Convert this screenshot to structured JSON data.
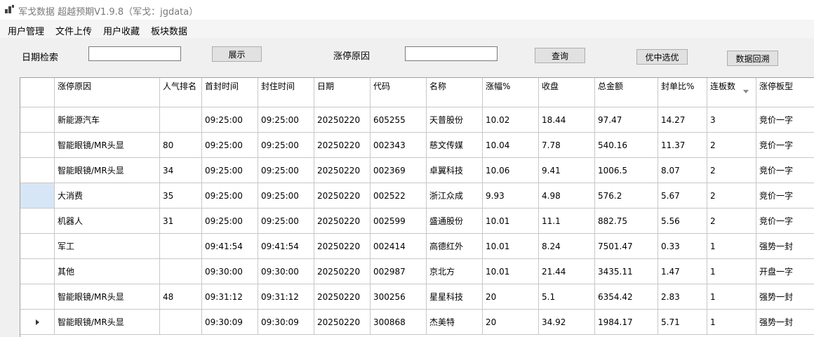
{
  "window": {
    "title": "军戈数据 超越预期V1.9.8（军戈：jgdata）"
  },
  "menu": [
    "用户管理",
    "文件上传",
    "用户收藏",
    "板块数据"
  ],
  "toolbar": {
    "date_label": "日期检索",
    "date_value": "",
    "show_button": "展示",
    "reason_label": "涨停原因",
    "reason_value": "",
    "query_button": "查询",
    "select_button": "优中选优",
    "backtest_button": "数据回溯"
  },
  "grid": {
    "columns": [
      [
        "涨停原因"
      ],
      [
        "人气",
        "排名"
      ],
      [
        "首封时",
        "间"
      ],
      [
        "封住时",
        "间"
      ],
      [
        "日期"
      ],
      [
        "代码"
      ],
      [
        "名称"
      ],
      [
        "涨幅%"
      ],
      [
        "收盘"
      ],
      [
        "总金额"
      ],
      [
        "封单",
        "比%"
      ],
      [
        "连板数"
      ],
      [
        "涨停板",
        "型"
      ]
    ],
    "rows": [
      [
        "新能源汽车",
        "",
        "09:25:00",
        "09:25:00",
        "20250220",
        "605255",
        "天普股份",
        "10.02",
        "18.44",
        "97.47",
        "14.27",
        "3",
        "竞价一字"
      ],
      [
        "智能眼镜/MR头显",
        "80",
        "09:25:00",
        "09:25:00",
        "20250220",
        "002343",
        "慈文传媒",
        "10.04",
        "7.78",
        "540.16",
        "11.37",
        "2",
        "竞价一字"
      ],
      [
        "智能眼镜/MR头显",
        "34",
        "09:25:00",
        "09:25:00",
        "20250220",
        "002369",
        "卓翼科技",
        "10.06",
        "9.41",
        "1006.5",
        "8.07",
        "2",
        "竞价一字"
      ],
      [
        "大消费",
        "35",
        "09:25:00",
        "09:25:00",
        "20250220",
        "002522",
        "浙江众成",
        "9.93",
        "4.98",
        "576.2",
        "5.67",
        "2",
        "竞价一字"
      ],
      [
        "机器人",
        "31",
        "09:25:00",
        "09:25:00",
        "20250220",
        "002599",
        "盛通股份",
        "10.01",
        "11.1",
        "882.75",
        "5.56",
        "2",
        "竞价一字"
      ],
      [
        "军工",
        "",
        "09:41:54",
        "09:41:54",
        "20250220",
        "002414",
        "高德红外",
        "10.01",
        "8.24",
        "7501.47",
        "0.33",
        "1",
        "强势一封"
      ],
      [
        "其他",
        "",
        "09:30:00",
        "09:30:00",
        "20250220",
        "002987",
        "京北方",
        "10.01",
        "21.44",
        "3435.11",
        "1.47",
        "1",
        "开盘一字"
      ],
      [
        "智能眼镜/MR头显",
        "48",
        "09:31:12",
        "09:31:12",
        "20250220",
        "300256",
        "星星科技",
        "20",
        "5.1",
        "6354.42",
        "2.83",
        "1",
        "强势一封"
      ],
      [
        "智能眼镜/MR头显",
        "",
        "09:30:09",
        "09:30:09",
        "20250220",
        "300868",
        "杰美特",
        "20",
        "34.92",
        "1984.17",
        "5.71",
        "1",
        "强势一封"
      ]
    ]
  }
}
